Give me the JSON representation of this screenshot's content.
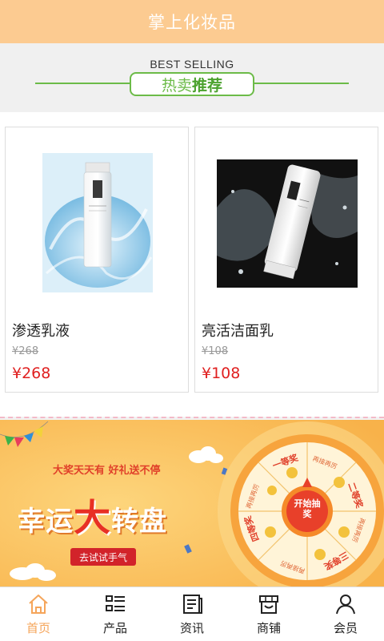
{
  "header": {
    "title": "掌上化妆品"
  },
  "section": {
    "eyebrow": "BEST SELLING",
    "title_prefix": "热卖",
    "title_bold": "推荐"
  },
  "products": [
    {
      "name": "渗透乳液",
      "old_price": "¥268",
      "price": "¥268"
    },
    {
      "name": "亮活洁面乳",
      "old_price": "¥108",
      "price": "¥108"
    }
  ],
  "banner": {
    "subtitle": "大奖天天有 好礼送不停",
    "title_a": "幸运",
    "title_big": "大",
    "title_b": "转盘",
    "button": "去试试手气",
    "wheel_center": "开始抽奖",
    "wheel_labels": [
      "一等奖",
      "二等奖",
      "三等奖",
      "四等奖",
      "再接再厉",
      "再接再厉",
      "再接再厉",
      "再接再厉"
    ]
  },
  "tabbar": [
    {
      "label": "首页",
      "icon": "home-icon",
      "active": true
    },
    {
      "label": "产品",
      "icon": "list-icon",
      "active": false
    },
    {
      "label": "资讯",
      "icon": "news-icon",
      "active": false
    },
    {
      "label": "商铺",
      "icon": "shop-icon",
      "active": false
    },
    {
      "label": "会员",
      "icon": "user-icon",
      "active": false
    }
  ],
  "colors": {
    "header": "#fccb91",
    "accent_green": "#6cbb48",
    "price_red": "#e02020",
    "active_tab": "#f5a55a"
  }
}
